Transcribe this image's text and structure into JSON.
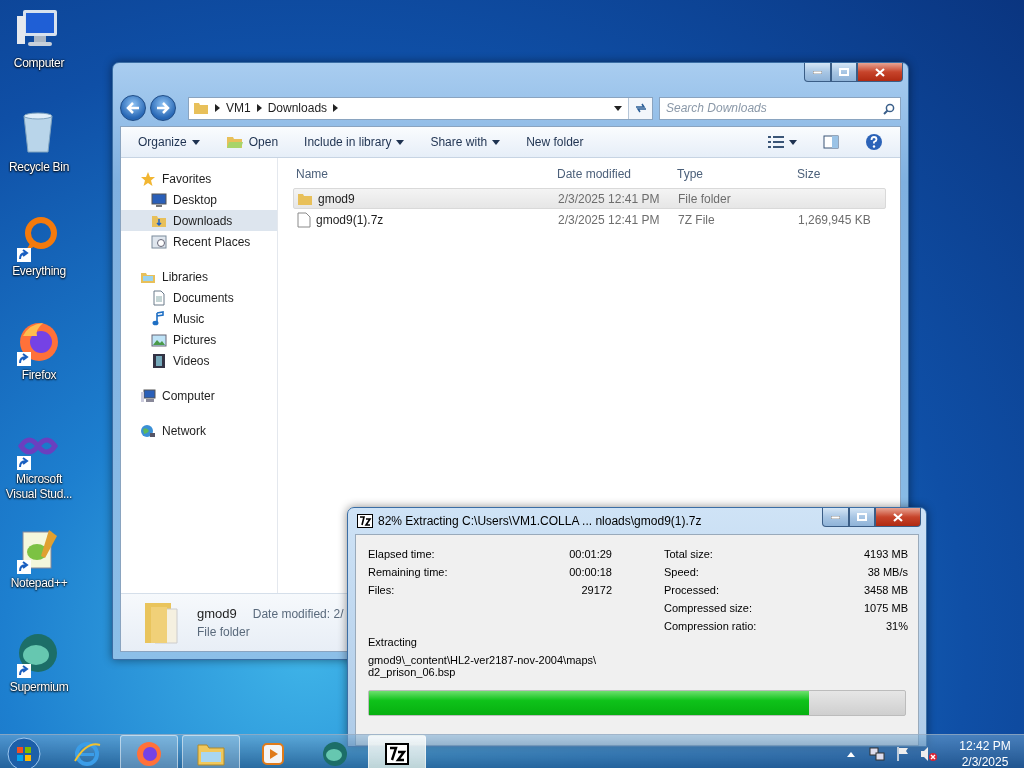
{
  "desktop_icons": [
    {
      "label": "Computer",
      "kind": "computer",
      "shortcut": false
    },
    {
      "label": "Recycle Bin",
      "kind": "recycle",
      "shortcut": false
    },
    {
      "label": "Everything",
      "kind": "ring",
      "shortcut": true
    },
    {
      "label": "Firefox",
      "kind": "firefox",
      "shortcut": true
    },
    {
      "label": "Microsoft Visual Stud...",
      "kind": "infinity",
      "shortcut": true
    },
    {
      "label": "Notepad++",
      "kind": "notepad",
      "shortcut": true
    },
    {
      "label": "Supermium",
      "kind": "supermium",
      "shortcut": true
    }
  ],
  "explorer": {
    "address": [
      "VM1",
      "Downloads"
    ],
    "search": {
      "placeholder": "Search Downloads"
    },
    "toolbar": [
      {
        "label": "Organize",
        "kind": "menu"
      },
      {
        "label": "Open",
        "kind": "icon"
      },
      {
        "label": "Include in library",
        "kind": "menu"
      },
      {
        "label": "Share with",
        "kind": "menu"
      },
      {
        "label": "New folder",
        "kind": "plain"
      }
    ],
    "nav": [
      {
        "label": "Favorites",
        "kind": "star",
        "children": [
          {
            "label": "Desktop",
            "kind": "desktop",
            "selected": false
          },
          {
            "label": "Downloads",
            "kind": "downloads",
            "selected": true
          },
          {
            "label": "Recent Places",
            "kind": "recent",
            "selected": false
          }
        ]
      },
      {
        "label": "Libraries",
        "kind": "library",
        "children": [
          {
            "label": "Documents",
            "kind": "documents",
            "selected": false
          },
          {
            "label": "Music",
            "kind": "music",
            "selected": false
          },
          {
            "label": "Pictures",
            "kind": "pictures",
            "selected": false
          },
          {
            "label": "Videos",
            "kind": "videos",
            "selected": false
          }
        ]
      },
      {
        "label": "Computer",
        "kind": "computer"
      },
      {
        "label": "Network",
        "kind": "network"
      }
    ],
    "columns": [
      "Name",
      "Date modified",
      "Type",
      "Size"
    ],
    "rows": [
      {
        "name": "gmod9",
        "date": "2/3/2025 12:41 PM",
        "type": "File folder",
        "kind": "folder",
        "selected": true
      },
      {
        "name": "gmod9(1).7z",
        "date": "2/3/2025 12:41 PM",
        "type": "7Z File",
        "size": "1,269,945 KB",
        "kind": "file",
        "selected": false
      }
    ],
    "details": {
      "name": "gmod9",
      "type": "File folder",
      "meta": "Date modified: 2/"
    }
  },
  "extract": {
    "title": "82% Extracting C:\\Users\\VM1.COLLA ... nloads\\gmod9(1).7z",
    "stats_left": [
      {
        "label": "Elapsed time:",
        "value": "00:01:29"
      },
      {
        "label": "Remaining time:",
        "value": "00:00:18"
      },
      {
        "label": "Files:",
        "value": "29172"
      }
    ],
    "stats_right": [
      {
        "label": "Total size:",
        "value": "4193 MB"
      },
      {
        "label": "Speed:",
        "value": "38 MB/s"
      },
      {
        "label": "Processed:",
        "value": "3458 MB"
      },
      {
        "label": "Compressed size:",
        "value": "1075 MB"
      },
      {
        "label": "Compression ratio:",
        "value": "31%"
      }
    ],
    "status": "Extracting",
    "file_lines": [
      "gmod9\\_content\\HL2-ver2187-nov-2004\\maps\\",
      "d2_prison_06.bsp"
    ],
    "progress": {
      "level": 0.82
    }
  },
  "taskbar": {
    "apps": [
      {
        "kind": "ie",
        "running": false,
        "selected": false
      },
      {
        "kind": "firefox",
        "running": true,
        "selected": false
      },
      {
        "kind": "explorer",
        "running": true,
        "selected": false
      },
      {
        "kind": "media",
        "running": false,
        "selected": false
      },
      {
        "kind": "supermium",
        "running": false,
        "selected": false
      },
      {
        "kind": "sevenzip",
        "running": true,
        "selected": true
      }
    ],
    "time": "12:42 PM",
    "date": "2/3/2025"
  }
}
